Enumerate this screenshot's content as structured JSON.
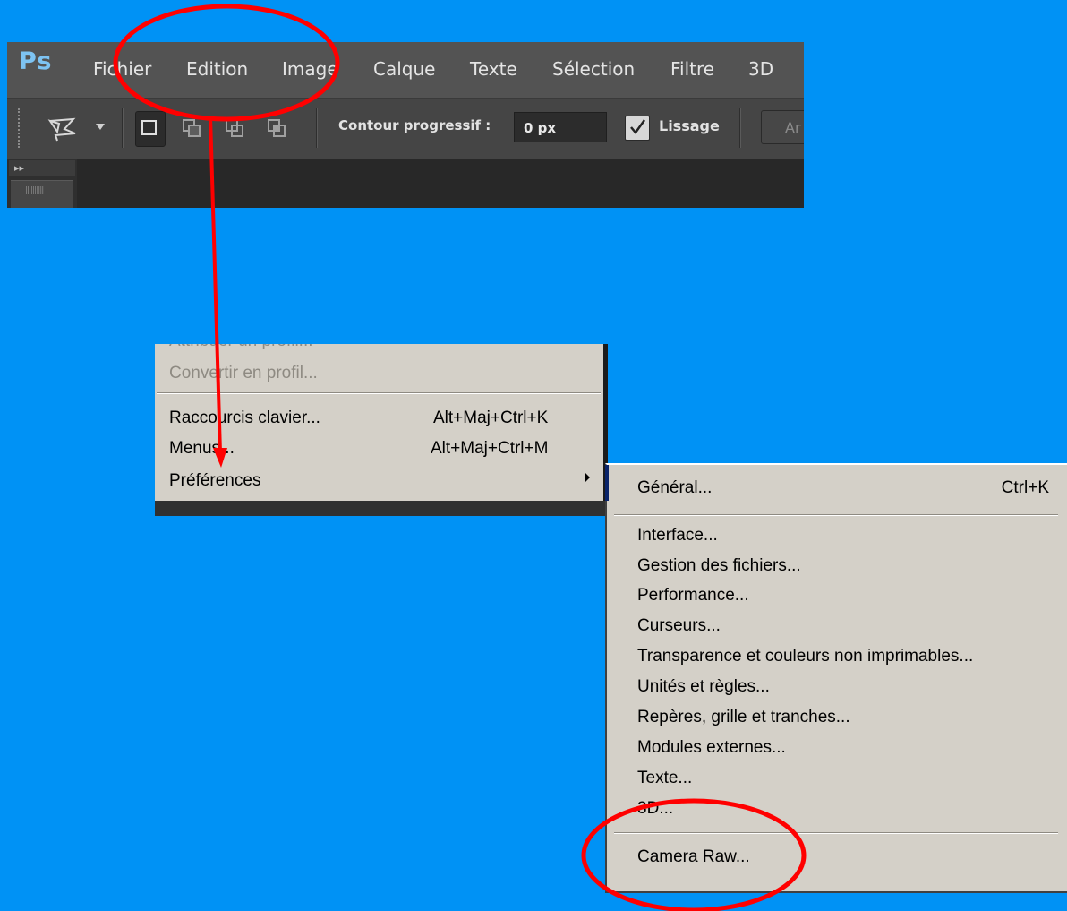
{
  "app": {
    "logo": "Ps",
    "menu": [
      "Fichier",
      "Edition",
      "Image",
      "Calque",
      "Texte",
      "Sélection",
      "Filtre",
      "3D"
    ]
  },
  "options_bar": {
    "tool_icon": "polygonal-lasso-icon",
    "feather_label": "Contour progressif :",
    "feather_value": "0 px",
    "antialias_label": "Lissage",
    "antialias_checked": true,
    "truncated_button": "Ar"
  },
  "panel": {
    "collapse_glyph": "▸▸",
    "tab_grip": "||||||||||"
  },
  "edit_menu": {
    "cut_item": "Attribuer un profil...",
    "convert_profile": "Convertir en profil...",
    "keyboard_shortcuts": {
      "label": "Raccourcis clavier...",
      "shortcut": "Alt+Maj+Ctrl+K"
    },
    "menus": {
      "label": "Menus...",
      "shortcut": "Alt+Maj+Ctrl+M"
    },
    "preferences": "Préférences"
  },
  "preferences_menu": {
    "general": {
      "label": "Général...",
      "shortcut": "Ctrl+K"
    },
    "items": [
      "Interface...",
      "Gestion des fichiers...",
      "Performance...",
      "Curseurs...",
      "Transparence et couleurs non imprimables...",
      "Unités et règles...",
      "Repères, grille et tranches...",
      "Modules externes...",
      "Texte...",
      "3D..."
    ],
    "camera_raw": "Camera Raw..."
  },
  "colors": {
    "background": "#0092f5",
    "annotation": "#ff0000"
  }
}
